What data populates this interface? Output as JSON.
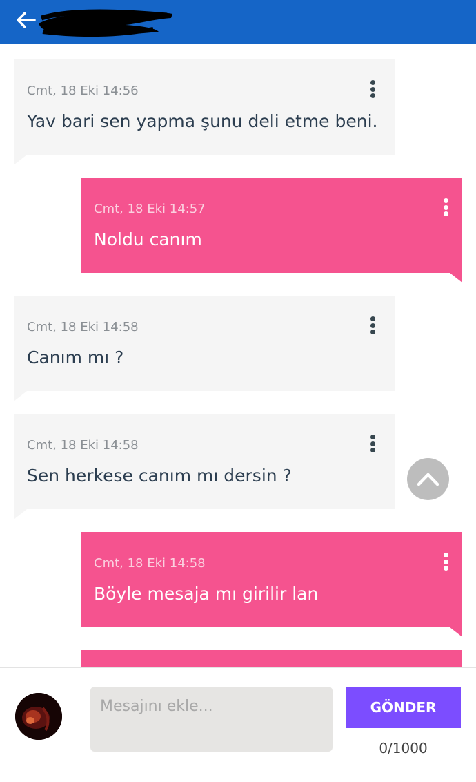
{
  "header": {
    "back_icon": "arrow-left-icon",
    "title_redacted": true,
    "color": "#1565c7"
  },
  "messages": [
    {
      "direction": "incoming",
      "time": "Cmt, 18 Eki 14:56",
      "text": "Yav bari sen yapma şunu deli etme beni.",
      "menu_icon": "more-vertical-icon"
    },
    {
      "direction": "outgoing",
      "time": "Cmt, 18 Eki 14:57",
      "text": "Noldu canım",
      "menu_icon": "more-vertical-icon"
    },
    {
      "direction": "incoming",
      "time": "Cmt, 18 Eki 14:58",
      "text": "Canım mı ?",
      "menu_icon": "more-vertical-icon"
    },
    {
      "direction": "incoming",
      "time": "Cmt, 18 Eki 14:58",
      "text": "Sen herkese canım mı dersin ?",
      "menu_icon": "more-vertical-icon"
    },
    {
      "direction": "outgoing",
      "time": "Cmt, 18 Eki 14:58",
      "text": "Böyle mesaja mı girilir lan",
      "menu_icon": "more-vertical-icon"
    },
    {
      "direction": "outgoing",
      "time": "",
      "text": "",
      "partial": true
    }
  ],
  "scroll_top_icon": "chevron-up-icon",
  "composer": {
    "placeholder": "Mesajını ekle...",
    "value": "",
    "send_label": "GÖNDER",
    "counter": "0/1000"
  },
  "colors": {
    "incoming_bubble": "#f5f5f5",
    "outgoing_bubble": "#f5538f",
    "send_button": "#7c4dff"
  }
}
